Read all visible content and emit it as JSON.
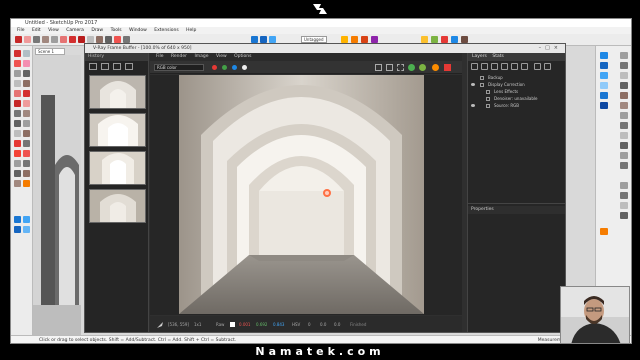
{
  "brand": "Namatek.com",
  "sketchup": {
    "title": "Untitled - SketchUp Pro 2017",
    "menu": [
      "File",
      "Edit",
      "View",
      "Camera",
      "Draw",
      "Tools",
      "Window",
      "Extensions",
      "Help"
    ],
    "scene_tab": "Scene 1",
    "toolbar_dropdown": "Untagged",
    "status_text": "Click or drag to select objects. Shift = Add/Subtract. Ctrl = Add. Shift + Ctrl = Subtract.",
    "measurements_label": "Measurements"
  },
  "vfb": {
    "title": "V-Ray Frame Buffer - [100.0% of 640 x 950]",
    "history_title": "History",
    "menu": [
      "File",
      "Render",
      "Image",
      "View",
      "Options"
    ],
    "channel_select": "RGB color",
    "status": {
      "coords": "[536, 559]",
      "swatch_label": "1x1",
      "mode": "Raw",
      "r": "0.001",
      "g": "0.692",
      "b": "0.843",
      "hsv": "HSV",
      "h": "0",
      "s": "0.0",
      "v": "0.0",
      "finished": "Finished"
    }
  },
  "layers": {
    "tabs": [
      "Layers",
      "Stats"
    ],
    "items": [
      {
        "label": "Backup",
        "indent": 0
      },
      {
        "label": "Display Correction",
        "indent": 0
      },
      {
        "label": "Lens Effects",
        "indent": 1
      },
      {
        "label": "Denoiser: unavailable",
        "indent": 1
      },
      {
        "label": "Source: RGB",
        "indent": 1
      }
    ],
    "properties_title": "Properties"
  },
  "colors": {
    "accent_red": "#e53935",
    "accent_green": "#43a047",
    "accent_blue": "#1e88e5",
    "vfb_bg": "#2f2f2f"
  }
}
